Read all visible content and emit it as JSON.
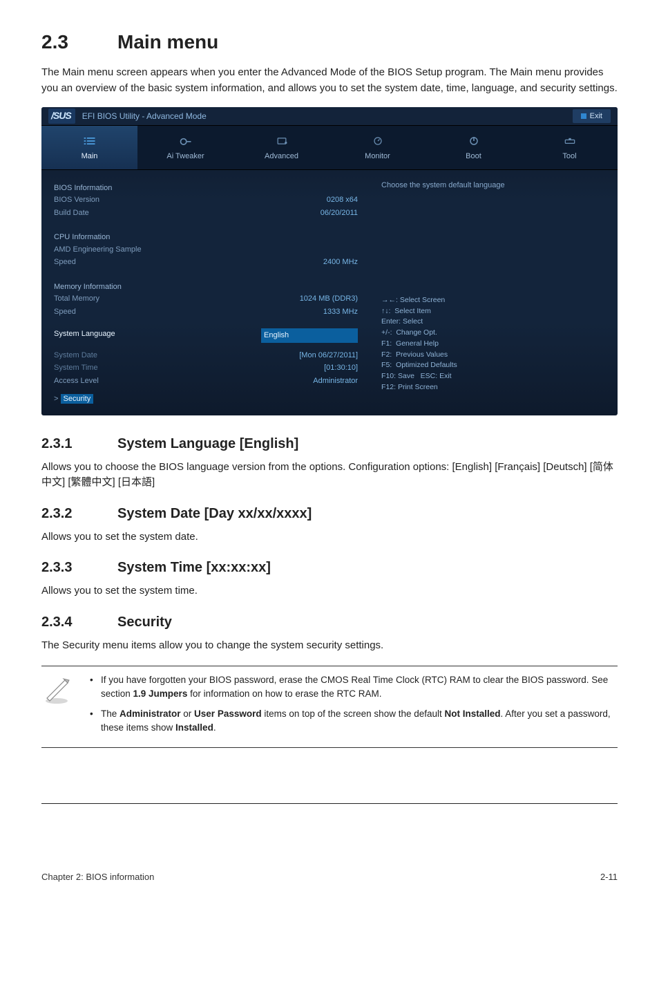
{
  "section": {
    "number": "2.3",
    "title": "Main menu",
    "intro": "The Main menu screen appears when you enter the Advanced Mode of the BIOS Setup program. The Main menu provides you an overview of the basic system information, and allows you to set the system date, time, language, and security settings."
  },
  "bios": {
    "logo": "/SUS",
    "title": "EFI BIOS Utility - Advanced Mode",
    "exit": "Exit",
    "tabs": {
      "main": "Main",
      "ai": "Ai  Tweaker",
      "adv": "Advanced",
      "mon": "Monitor",
      "boot": "Boot",
      "tool": "Tool"
    },
    "groups": {
      "bios_info": "BIOS Information",
      "bios_ver_l": "BIOS Version",
      "bios_ver_v": "0208 x64",
      "build_l": "Build Date",
      "build_v": "06/20/2011",
      "cpu_info": "CPU Information",
      "amd_l": "AMD Engineering Sample",
      "speed_l": "Speed",
      "speed_v": "2400 MHz",
      "mem_info": "Memory Information",
      "tmem_l": "Total Memory",
      "tmem_v": "1024 MB (DDR3)",
      "mspd_l": "Speed",
      "mspd_v": "1333 MHz",
      "lang_l": "System Language",
      "lang_v": "English",
      "date_l": "System Date",
      "date_v": "[Mon 06/27/2011]",
      "time_l": "System Time",
      "time_v": "[01:30:10]",
      "acc_l": "Access Level",
      "acc_v": "Administrator",
      "sec_l": "Security",
      "sec_prefix": ">"
    },
    "right_top": "Choose the system default language",
    "hints": {
      "l1": "→←: Select Screen",
      "l2": "↑↓:  Select Item",
      "l3": "Enter: Select",
      "l4": "+/-:  Change Opt.",
      "l5": "F1:  General Help",
      "l6": "F2:  Previous Values",
      "l7": "F5:  Optimized Defaults",
      "l8": "F10: Save   ESC: Exit",
      "l9": "F12: Print Screen"
    }
  },
  "sub1": {
    "num": "2.3.1",
    "title": "System Language [English]",
    "body": "Allows you to choose the BIOS language version from the options. Configuration options: [English] [Français] [Deutsch] [简体中文] [繁體中文] [日本語]"
  },
  "sub2": {
    "num": "2.3.2",
    "title": "System Date [Day xx/xx/xxxx]",
    "body": "Allows you to set the system date."
  },
  "sub3": {
    "num": "2.3.3",
    "title": "System Time [xx:xx:xx]",
    "body": "Allows you to set the system time."
  },
  "sub4": {
    "num": "2.3.4",
    "title": "Security",
    "body": "The Security menu items allow you to change the system security settings."
  },
  "note": {
    "b1a": "If you have forgotten your BIOS password, erase the CMOS Real Time Clock (RTC) RAM to clear the BIOS password. See section ",
    "b1b": "1.9 Jumpers",
    "b1c": " for information on how to erase the RTC RAM.",
    "b2a": "The ",
    "b2b": "Administrator",
    "b2c": " or ",
    "b2d": "User Password",
    "b2e": " items on top of the screen show the default ",
    "b2f": "Not Installed",
    "b2g": ". After you set a password, these items show ",
    "b2h": "Installed",
    "b2i": "."
  },
  "footer": {
    "left": "Chapter 2: BIOS information",
    "right": "2-11"
  }
}
